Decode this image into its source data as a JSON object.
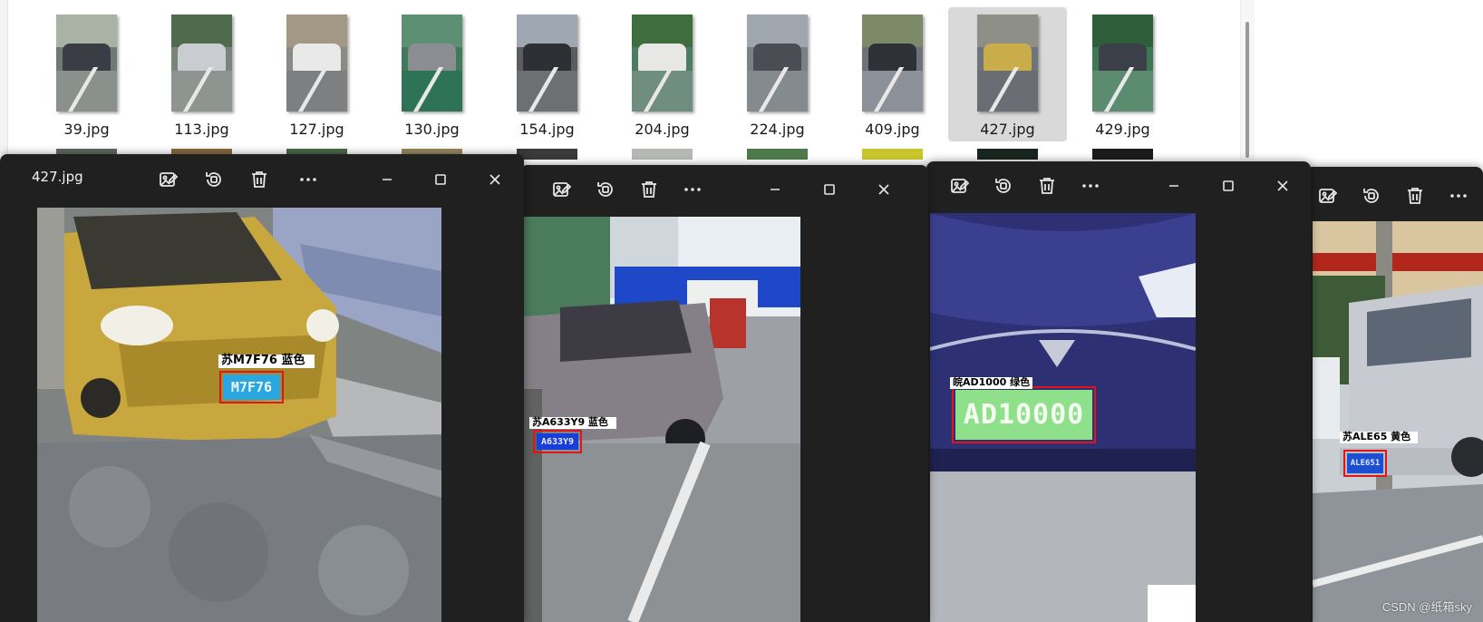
{
  "explorer": {
    "thumbnails": [
      {
        "name": "39.jpg"
      },
      {
        "name": "113.jpg"
      },
      {
        "name": "127.jpg"
      },
      {
        "name": "130.jpg"
      },
      {
        "name": "154.jpg"
      },
      {
        "name": "204.jpg"
      },
      {
        "name": "224.jpg"
      },
      {
        "name": "409.jpg"
      },
      {
        "name": "427.jpg",
        "selected": true
      },
      {
        "name": "429.jpg"
      }
    ]
  },
  "viewers": [
    {
      "title": "427.jpg",
      "toolbar": [
        "edit-image-icon",
        "rotate-icon",
        "delete-icon",
        "more-icon"
      ],
      "window_controls": [
        "minimize-icon",
        "maximize-icon",
        "close-icon"
      ],
      "detection": {
        "label": "苏M7F76 蓝色",
        "plate_text": "M7F76",
        "plate_color": "#2aa6e0"
      }
    },
    {
      "title": "",
      "toolbar": [
        "edit-image-icon",
        "rotate-icon",
        "delete-icon",
        "more-icon"
      ],
      "window_controls": [
        "minimize-icon",
        "maximize-icon",
        "close-icon"
      ],
      "detection": {
        "label": "苏A633Y9 蓝色",
        "plate_text": "A633Y9",
        "plate_color": "#1a3fd8"
      }
    },
    {
      "title": "",
      "toolbar": [
        "edit-image-icon",
        "rotate-icon",
        "delete-icon",
        "more-icon"
      ],
      "window_controls": [
        "minimize-icon",
        "maximize-icon",
        "close-icon"
      ],
      "detection": {
        "label": "皖AD1000 绿色",
        "plate_text": "AD10000",
        "plate_color": "#8fe08a"
      }
    },
    {
      "title": "",
      "toolbar": [
        "edit-image-icon",
        "rotate-icon",
        "delete-icon",
        "more-icon"
      ],
      "window_controls": [],
      "detection": {
        "label": "苏ALE65 黄色",
        "plate_text": "ALE651",
        "plate_color": "#1e4fd0"
      }
    }
  ],
  "watermark": "CSDN @纸箱sky",
  "colors": {
    "window_bg": "#202020",
    "box_red": "#e0141b",
    "selected_tile": "#d9d9d9"
  }
}
